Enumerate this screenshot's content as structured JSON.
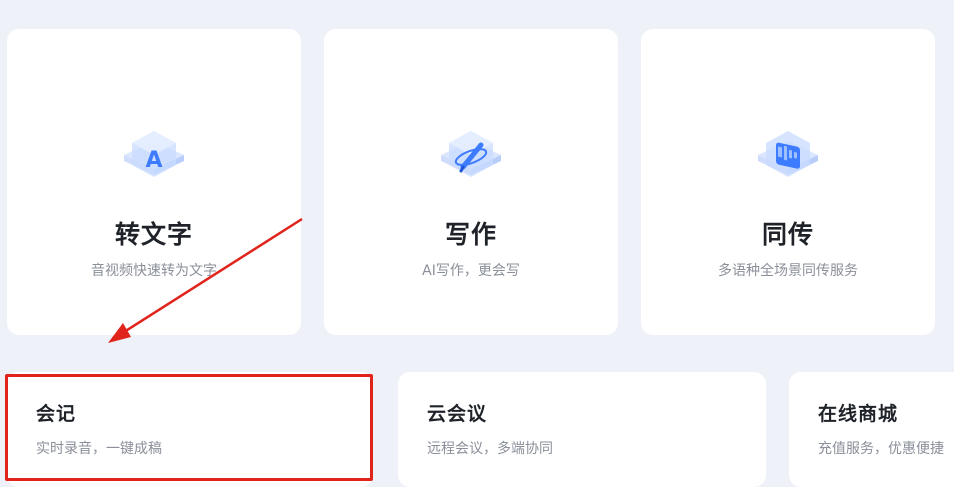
{
  "feature_cards": [
    {
      "title": "转文字",
      "desc": "音视频快速转为文字",
      "icon": "text-a-icon"
    },
    {
      "title": "写作",
      "desc": "AI写作，更会写",
      "icon": "pen-write-icon"
    },
    {
      "title": "同传",
      "desc": "多语种全场景同传服务",
      "icon": "translate-icon"
    }
  ],
  "service_cards": [
    {
      "title": "会记",
      "desc": "实时录音，一键成稿"
    },
    {
      "title": "云会议",
      "desc": "远程会议，多端协同"
    },
    {
      "title": "在线商城",
      "desc": "充值服务，优惠便捷"
    }
  ],
  "annotation": {
    "arrow_color": "#e0231b",
    "box_color": "#e0231b"
  },
  "colors": {
    "background": "#eef1f8",
    "card": "#ffffff",
    "icon_blue": "#3d7bff"
  }
}
